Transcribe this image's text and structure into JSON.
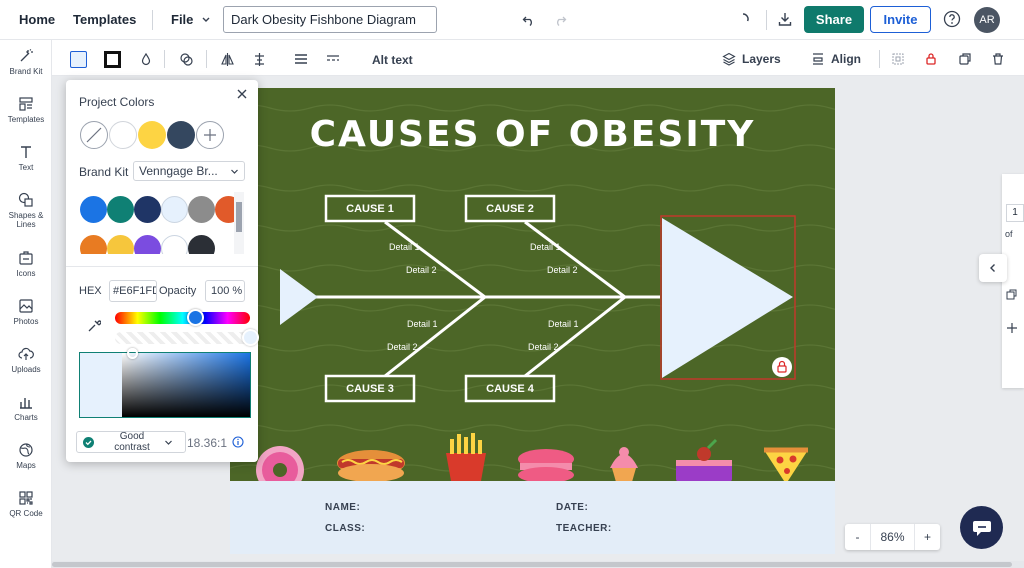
{
  "topbar": {
    "home": "Home",
    "templates": "Templates",
    "file": "File",
    "doc_title": "Dark Obesity Fishbone Diagram",
    "share": "Share",
    "invite": "Invite",
    "avatar": "AR"
  },
  "sidebar": {
    "items": [
      {
        "label": "Brand Kit",
        "icon": "wand-icon"
      },
      {
        "label": "Templates",
        "icon": "templates-icon"
      },
      {
        "label": "Text",
        "icon": "text-icon"
      },
      {
        "label": "Shapes & Lines",
        "icon": "shapes-icon"
      },
      {
        "label": "Icons",
        "icon": "icons-icon"
      },
      {
        "label": "Photos",
        "icon": "photo-icon"
      },
      {
        "label": "Uploads",
        "icon": "upload-icon"
      },
      {
        "label": "Charts",
        "icon": "chart-icon"
      },
      {
        "label": "Maps",
        "icon": "globe-icon"
      },
      {
        "label": "QR Code",
        "icon": "qr-icon"
      }
    ]
  },
  "toolbar": {
    "alt_text": "Alt text",
    "layers": "Layers",
    "align": "Align"
  },
  "color_panel": {
    "project_colors_title": "Project Colors",
    "project_colors": [
      "#ffffff",
      "#fdd443",
      "#34475f"
    ],
    "brand_kit_label": "Brand Kit",
    "brand_kit_value": "Venngage Br...",
    "brand_colors_row1": [
      "#1b74e4",
      "#0f8074",
      "#1f3566",
      "#e6f1fd",
      "#8c8c8c",
      "#e15a2a"
    ],
    "brand_colors_row2": [
      "#e87b22",
      "#f6c63c",
      "#7b4ce0",
      "#ffffff",
      "#2b2f36"
    ],
    "hex_label": "HEX",
    "hex_value": "#E6F1FD",
    "opacity_label": "Opacity",
    "opacity_value": "100",
    "opacity_unit": "%",
    "contrast_label": "Good contrast",
    "contrast_ratio": "18.36:1"
  },
  "canvas": {
    "title": "CAUSES OF OBESITY",
    "causes": [
      "CAUSE 1",
      "CAUSE 2",
      "CAUSE 3",
      "CAUSE 4"
    ],
    "detail1": "Detail 1",
    "detail2": "Detail 2",
    "footer": {
      "name": "NAME:",
      "class": "CLASS:",
      "date": "DATE:",
      "teacher": "TEACHER:"
    }
  },
  "zoom": {
    "minus": "-",
    "value": "86",
    "unit": "%",
    "plus": "+"
  },
  "right_rail": {
    "page_num": "1",
    "of": "of"
  }
}
